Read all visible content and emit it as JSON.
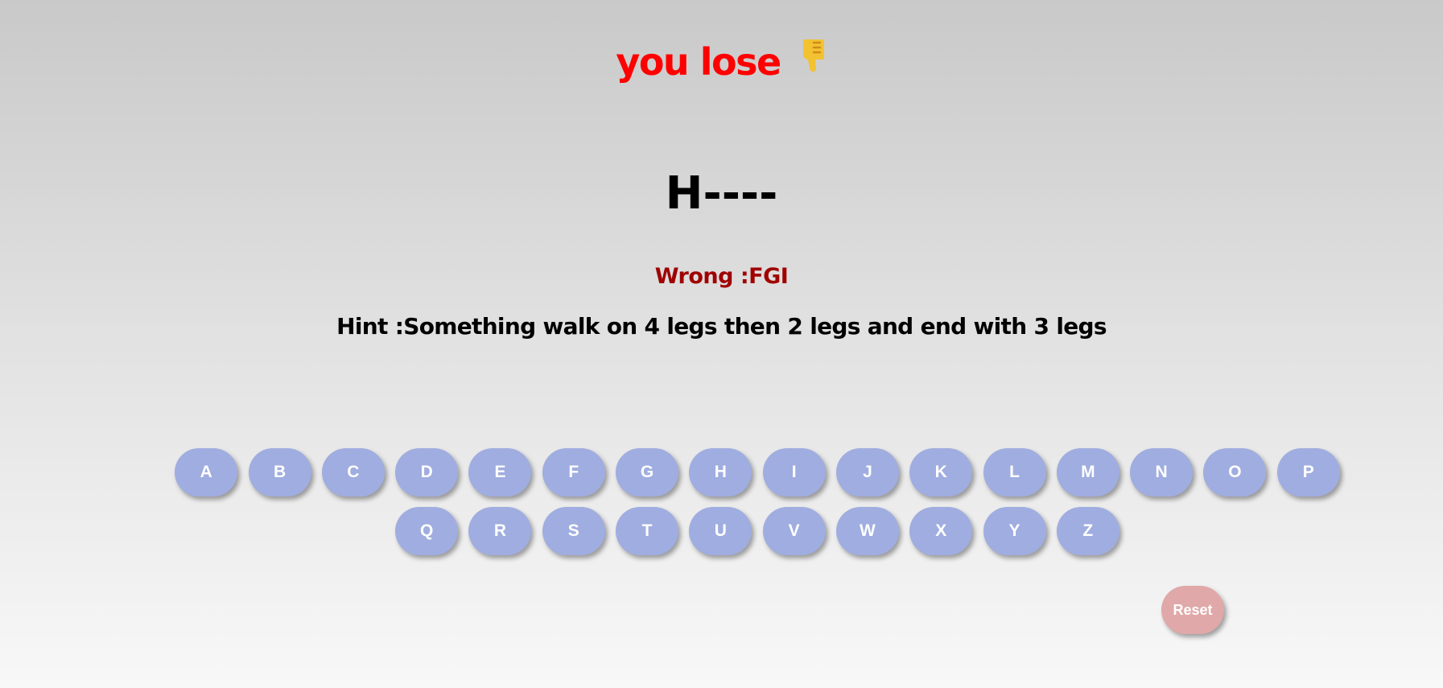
{
  "status": {
    "text": "you lose",
    "icon": "thumbs-down-icon"
  },
  "word": {
    "display": "H----"
  },
  "wrong": {
    "label": "Wrong :",
    "letters": "FGI"
  },
  "hint": {
    "label": "Hint :",
    "text": "Something walk on 4 legs then 2 legs and end with 3 legs"
  },
  "keyboard": {
    "row1": [
      "A",
      "B",
      "C",
      "D",
      "E",
      "F",
      "G",
      "H",
      "I",
      "J",
      "K",
      "L",
      "M",
      "N",
      "O",
      "P"
    ],
    "row2": [
      "Q",
      "R",
      "S",
      "T",
      "U",
      "V",
      "W",
      "X",
      "Y",
      "Z"
    ]
  },
  "reset": {
    "label": "Reset"
  },
  "colors": {
    "status": "#ff0000",
    "wrong": "#a00000",
    "key": "#a0ade0",
    "reset": "#e0a8a8",
    "thumb": "#f2c230"
  }
}
